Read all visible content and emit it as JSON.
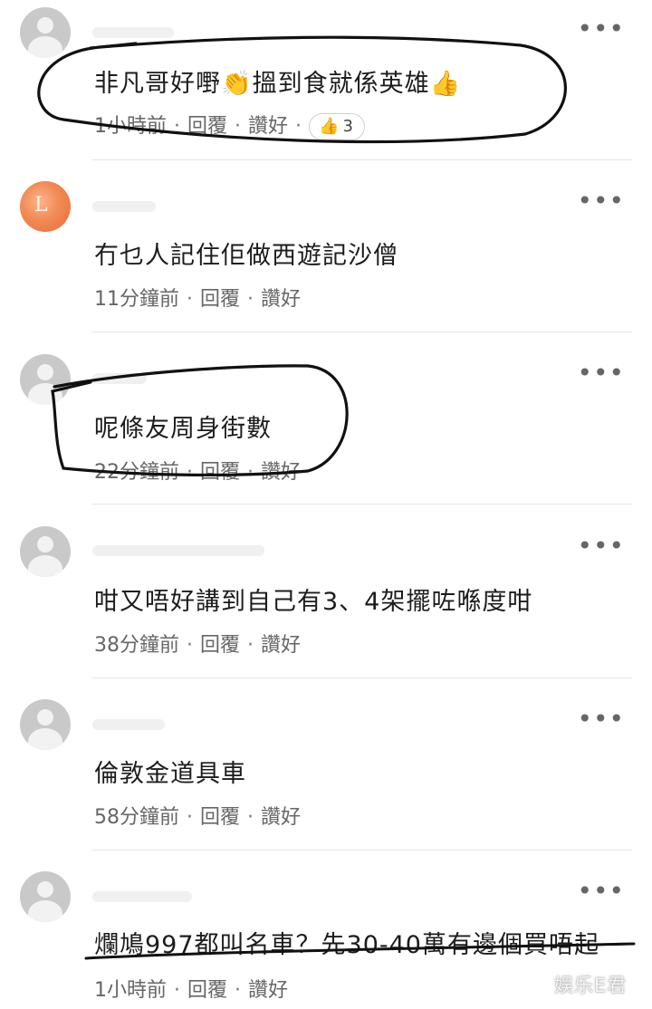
{
  "comments": [
    {
      "text": "非凡哥好嘢👏搵到食就係英雄👍",
      "time": "1小時前",
      "reply": "回覆",
      "like": "讚好",
      "reaction": {
        "icon": "thumbs-up",
        "count": "3"
      },
      "avatar": "gray"
    },
    {
      "text": "冇乜人記住佢做西遊記沙僧",
      "time": "11分鐘前",
      "reply": "回覆",
      "like": "讚好",
      "avatar": "orange",
      "avatar_letter": "L"
    },
    {
      "text": "呢條友周身街數",
      "time": "22分鐘前",
      "reply": "回覆",
      "like": "讚好",
      "avatar": "gray"
    },
    {
      "text": "咁又唔好講到自己有3、4架擺咗喺度咁",
      "time": "38分鐘前",
      "reply": "回覆",
      "like": "讚好",
      "avatar": "gray"
    },
    {
      "text": "倫敦金道具車",
      "time": "58分鐘前",
      "reply": "回覆",
      "like": "讚好",
      "avatar": "gray"
    },
    {
      "text": "爛鳩997都叫名車？先30-40萬有邊個買唔起",
      "time": "1小時前",
      "reply": "回覆",
      "like": "讚好",
      "avatar": "gray"
    }
  ],
  "more_icon": "•••",
  "watermark": "娱乐E君"
}
